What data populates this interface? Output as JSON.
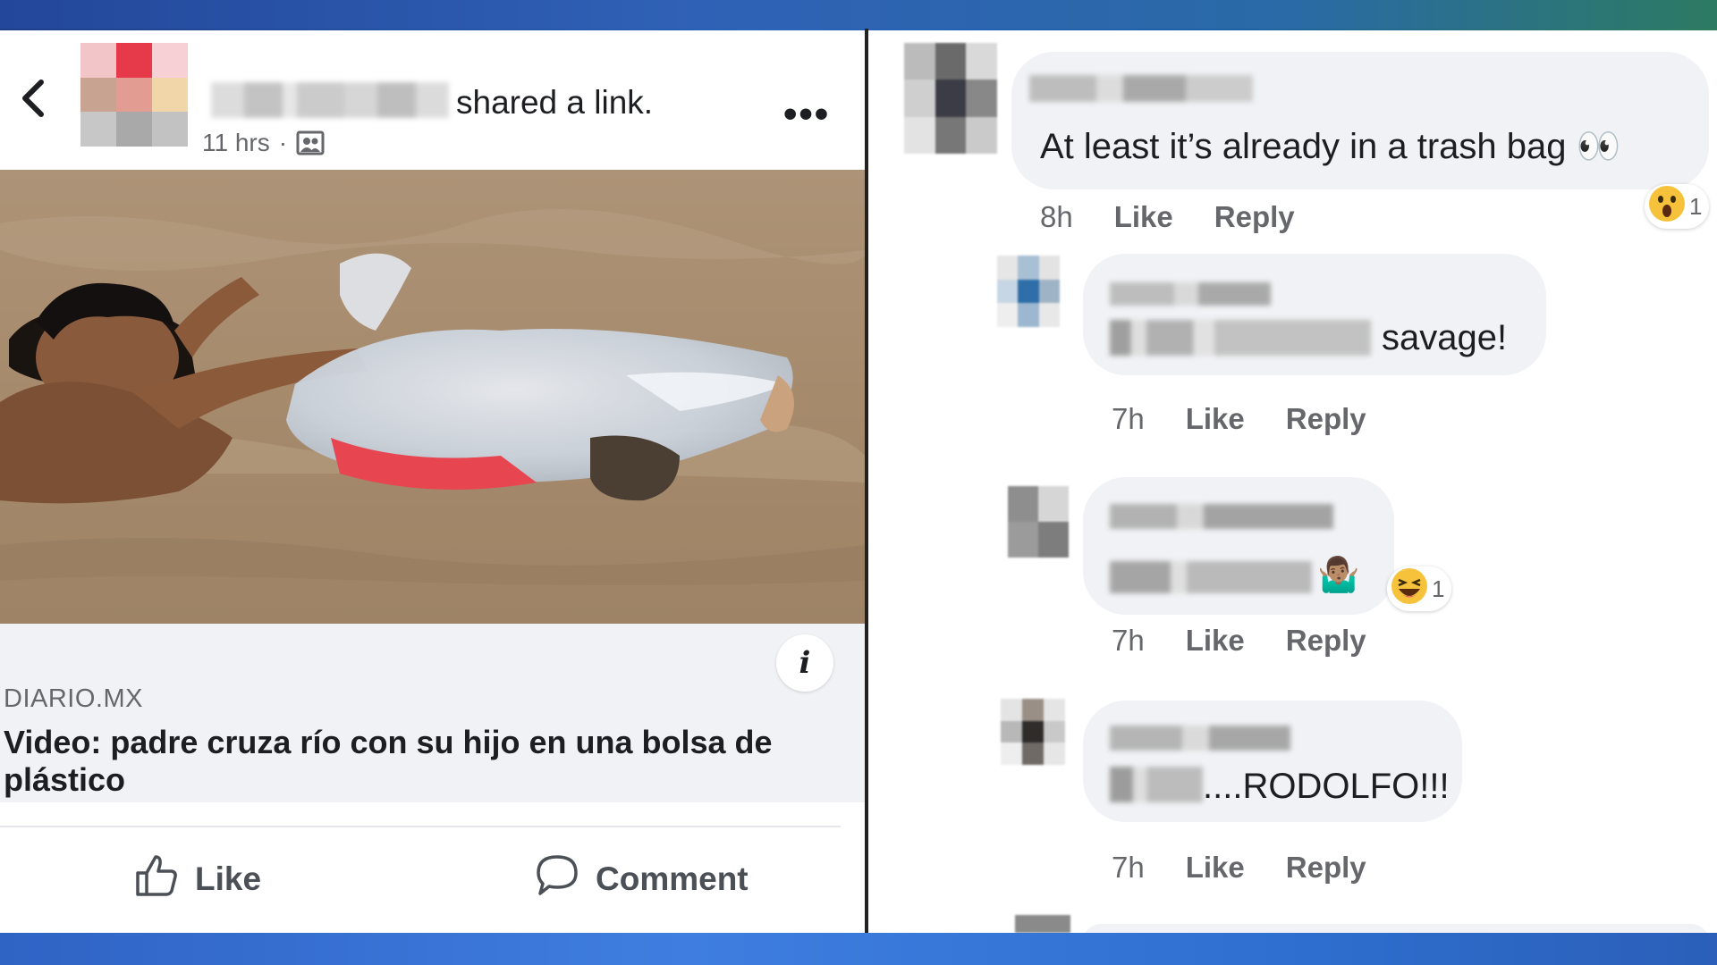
{
  "post": {
    "shared_text": "shared a link.",
    "time": "11 hrs",
    "separator": "·",
    "more_label": "•••",
    "link": {
      "domain": "DIARIO.MX",
      "title": "Video: padre cruza río con su hijo en una bolsa de plástico",
      "info_label": "i"
    },
    "actions": {
      "like_label": "Like",
      "comment_label": "Comment"
    }
  },
  "comments": [
    {
      "text": "At least it’s already in a trash bag 👀",
      "time": "8h",
      "like_label": "Like",
      "reply_label": "Reply",
      "reaction_count": "1"
    },
    {
      "text": "savage!",
      "time": "7h",
      "like_label": "Like",
      "reply_label": "Reply"
    },
    {
      "text": "🤷🏽‍♂️",
      "time": "7h",
      "like_label": "Like",
      "reply_label": "Reply",
      "reaction_count": "1"
    },
    {
      "text": "....RODOLFO!!!",
      "time": "7h",
      "like_label": "Like",
      "reply_label": "Reply"
    }
  ],
  "colors": {
    "facebook_gray": "#65676b",
    "bubble": "#f0f2f5",
    "text": "#1c1e21"
  }
}
